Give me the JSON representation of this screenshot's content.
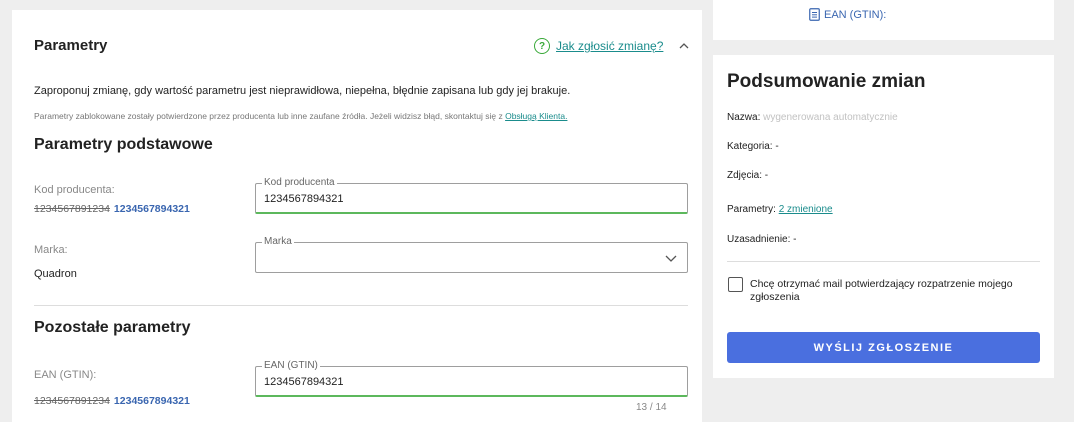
{
  "params": {
    "header": "Parametry",
    "help_link": "Jak zgłosić zmianę?",
    "intro": "Zaproponuj zmianę, gdy wartość parametru jest nieprawidłowa, niepełna, błędnie zapisana lub gdy jej brakuje.",
    "note_text": "Parametry zablokowane zostały potwierdzone przez producenta lub inne zaufane źródła. Jeżeli widzisz błąd, skontaktuj się z",
    "note_link": "Obsługą Klienta.",
    "basic_title": "Parametry podstawowe",
    "other_title": "Pozostałe parametry",
    "producer_code": {
      "label": "Kod producenta:",
      "old_value": "1234567891234",
      "new_value": "1234567894321",
      "field_legend": "Kod producenta",
      "field_value": "1234567894321"
    },
    "brand": {
      "label": "Marka:",
      "value": "Quadron",
      "field_legend": "Marka"
    },
    "ean": {
      "label": "EAN (GTIN):",
      "old_value": "1234567891234",
      "new_value": "1234567894321",
      "field_legend": "EAN (GTIN)",
      "field_value": "1234567894321",
      "counter": "13 / 14"
    }
  },
  "right_top": {
    "ean_label": "EAN (GTIN):"
  },
  "summary": {
    "title": "Podsumowanie zmian",
    "name_label": "Nazwa:",
    "name_value": "wygenerowana automatycznie",
    "category": "Kategoria: -",
    "photos": "Zdjęcia: -",
    "params_label": "Parametry:",
    "params_link": "2 zmienione",
    "justification": "Uzasadnienie: -",
    "checkbox_label": "Chcę otrzymać mail potwierdzający rozpatrzenie mojego zgłoszenia",
    "submit": "WYŚLIJ ZGŁOSZENIE"
  },
  "colors": {
    "accent": "#4a6fdf",
    "link": "#1a8c8c",
    "new_value": "#3a66b0",
    "field_active": "#5cb85c"
  }
}
